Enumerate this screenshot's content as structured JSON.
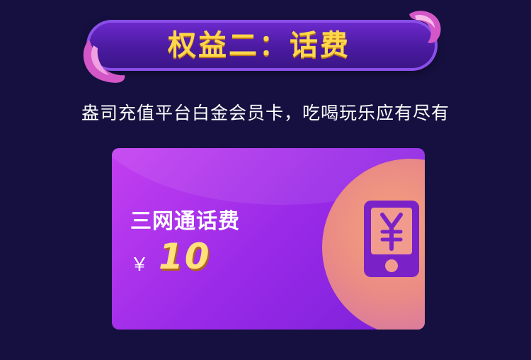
{
  "banner": {
    "title": "权益二：话费"
  },
  "subtitle": "盎司充值平台白金会员卡，吃喝玩乐应有尽有",
  "card": {
    "title": "三网通话费",
    "currency": "￥",
    "amount": "10",
    "icon": "phone-yuan-icon"
  },
  "colors": {
    "background": "#15103f",
    "accent": "#ffd84a",
    "card": "#9a2ae8"
  }
}
